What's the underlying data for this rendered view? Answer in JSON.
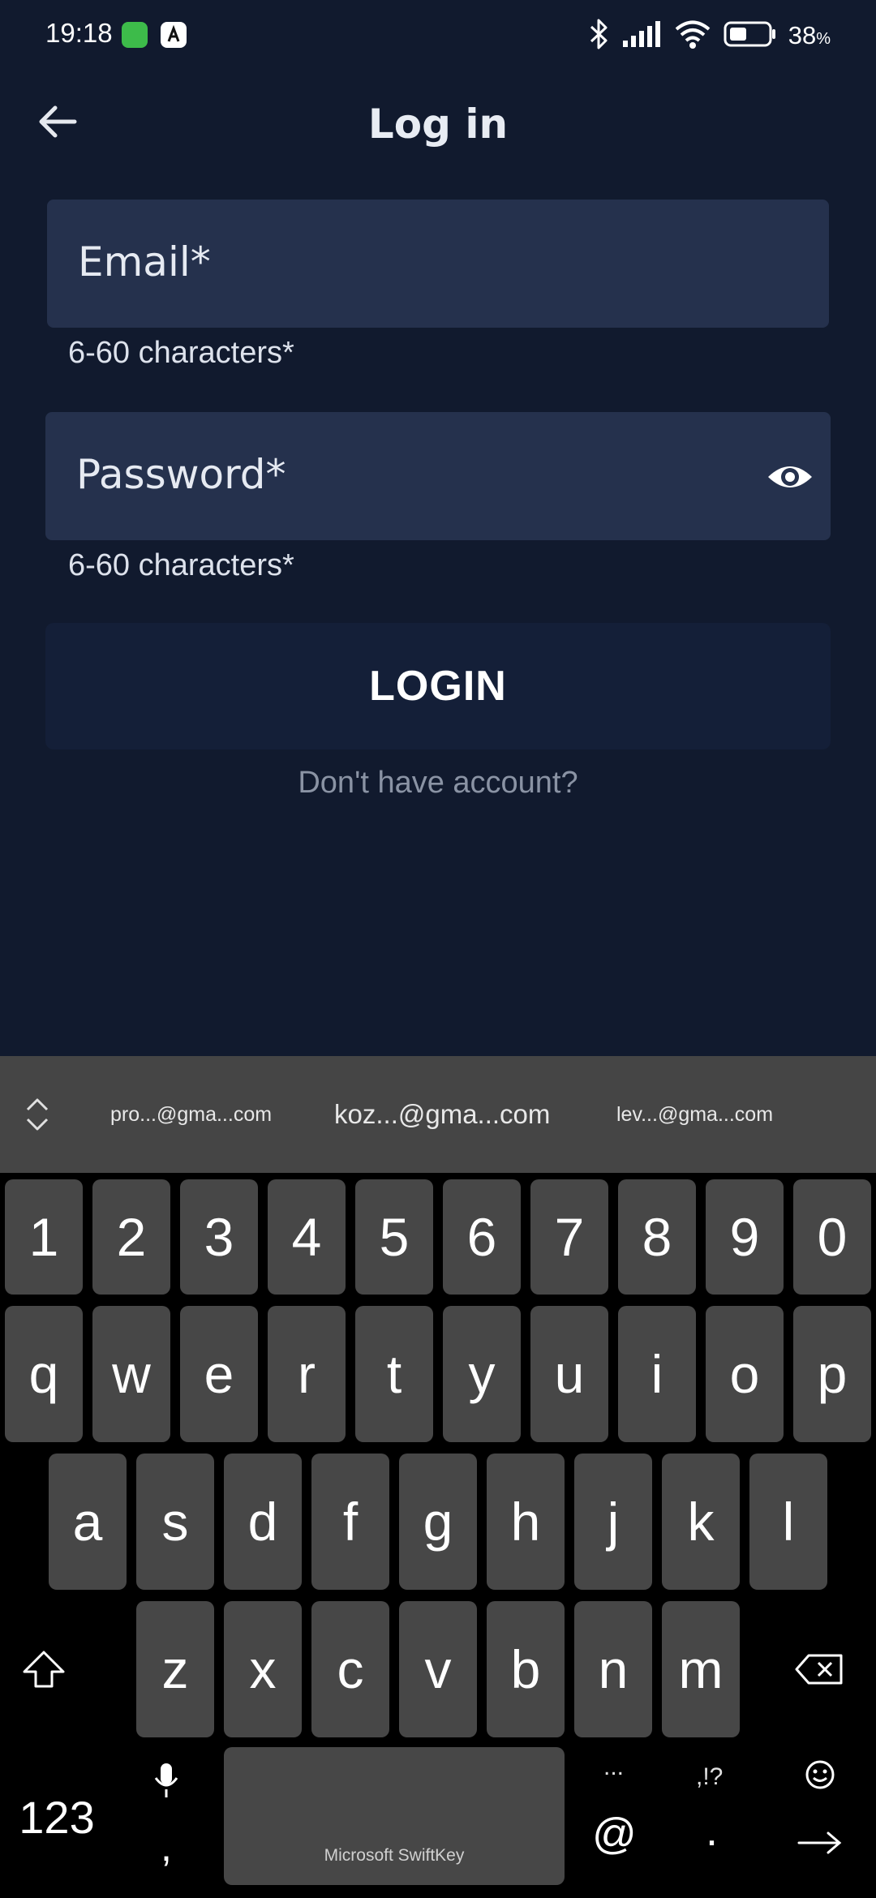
{
  "status_bar": {
    "time": "19:18",
    "battery_percent": "38",
    "battery_unit": "%"
  },
  "header": {
    "title": "Log in",
    "back_icon": "arrow-left-icon"
  },
  "form": {
    "email_label": "Email*",
    "email_hint": "6-60 characters*",
    "password_label": "Password*",
    "password_hint": "6-60 characters*",
    "password_toggle_icon": "eye-icon",
    "login_button": "LOGIN",
    "signup_link": "Don't have account?"
  },
  "keyboard": {
    "suggestions": [
      "pro...@gma...com",
      "koz...@gma...com",
      "lev...@gma...com"
    ],
    "number_row": [
      "1",
      "2",
      "3",
      "4",
      "5",
      "6",
      "7",
      "8",
      "9",
      "0"
    ],
    "row1": [
      "q",
      "w",
      "e",
      "r",
      "t",
      "y",
      "u",
      "i",
      "o",
      "p"
    ],
    "row2": [
      "a",
      "s",
      "d",
      "f",
      "g",
      "h",
      "j",
      "k",
      "l"
    ],
    "row3": [
      "z",
      "x",
      "c",
      "v",
      "b",
      "n",
      "m"
    ],
    "numbers_key": "123",
    "comma_key": ",",
    "space_label": "Microsoft SwiftKey",
    "ellipsis_hint": "...",
    "at_key": "@",
    "punct_hint": ",!?",
    "period_key": "."
  },
  "colors": {
    "background": "#111a2e",
    "field_background": "#25314d",
    "button_background": "#141f38",
    "link_text": "#8a93a4",
    "key_background": "#474747"
  }
}
